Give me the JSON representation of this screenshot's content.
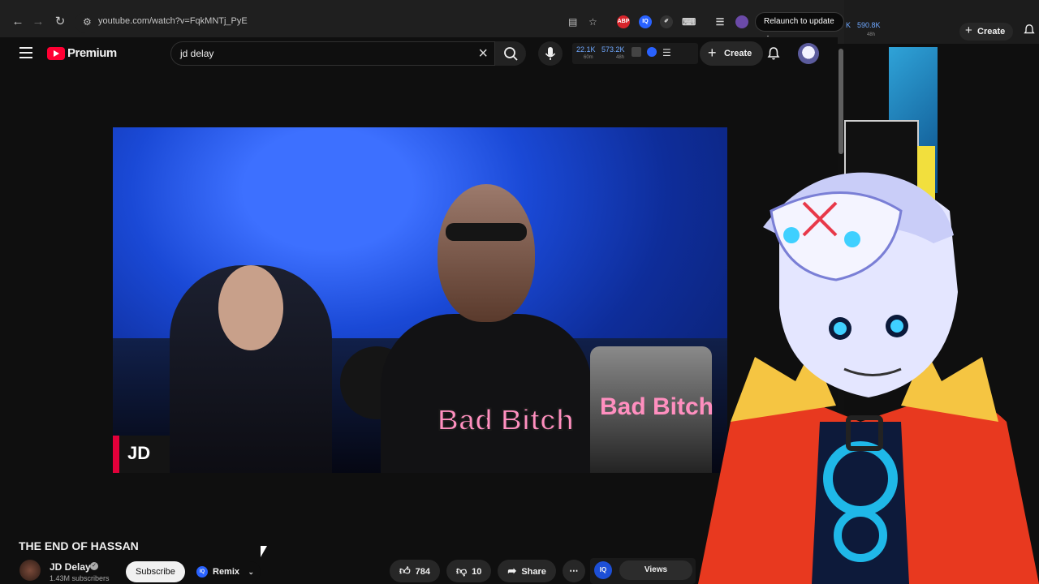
{
  "browser": {
    "url": "youtube.com/watch?v=FqkMNTj_PyE",
    "relaunch_label": "Relaunch to update",
    "extensions": [
      "ABP",
      "IQ"
    ]
  },
  "header": {
    "logo_text": "Premium",
    "search_query": "jd delay",
    "stats": {
      "value_a": "22.1K",
      "value_b": "573.2K",
      "sub_a": "60m",
      "sub_b": "48h"
    },
    "create_label": "Create"
  },
  "video": {
    "badge_text": "JD",
    "shirt_text": "Bad Bitch",
    "cup_text": "Bad Bitch"
  },
  "meta": {
    "title": "THE END OF HASSAN",
    "channel_name": "JD Delay",
    "subscribers": "1.43M subscribers",
    "subscribe_label": "Subscribe",
    "remix_label": "Remix",
    "likes": "784",
    "dislikes": "10",
    "share_label": "Share",
    "views_label": "Views",
    "iq_label": "IQ"
  },
  "side_window": {
    "stat_a": "K",
    "stat_b": "590.8K",
    "stat_sub": "48h",
    "create_label": "Create"
  },
  "colors": {
    "accent_red": "#ff0033",
    "iq_blue": "#2962ff",
    "vtuber_jacket": "#e8391f",
    "vtuber_fur": "#f5c542"
  }
}
